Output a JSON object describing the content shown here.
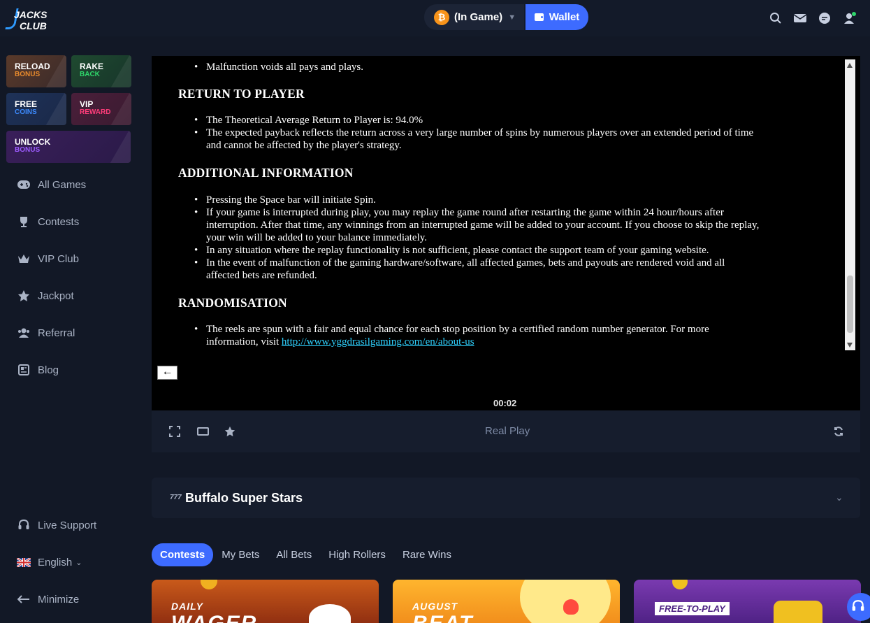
{
  "brand": {
    "logo_line1": "JACKS",
    "logo_line2": "CLUB"
  },
  "header": {
    "balance_label": "(In Game)",
    "currency_icon": "bitcoin-icon",
    "wallet_label": "Wallet",
    "icons": [
      "search-icon",
      "mail-icon",
      "chat-icon",
      "user-icon"
    ]
  },
  "promos": [
    {
      "line1": "RELOAD",
      "line2": "BONUS",
      "color": "#e88a2d"
    },
    {
      "line1": "RAKE",
      "line2": "BACK",
      "color": "#2fd56a"
    },
    {
      "line1": "FREE",
      "line2": "COINS",
      "color": "#3d8bff"
    },
    {
      "line1": "VIP",
      "line2": "REWARD",
      "color": "#ff3d7a"
    },
    {
      "line1": "UNLOCK",
      "line2": "BONUS",
      "color": "#9d5bff"
    }
  ],
  "sidebar": {
    "items": [
      {
        "label": "All Games",
        "icon": "gamepad-icon"
      },
      {
        "label": "Contests",
        "icon": "trophy-icon"
      },
      {
        "label": "VIP Club",
        "icon": "crown-icon"
      },
      {
        "label": "Jackpot",
        "icon": "star-icon"
      },
      {
        "label": "Referral",
        "icon": "people-icon"
      },
      {
        "label": "Blog",
        "icon": "blog-icon"
      }
    ],
    "bottom": [
      {
        "label": "Live Support",
        "icon": "headset-icon"
      },
      {
        "label": "English",
        "icon": "uk-flag-icon"
      },
      {
        "label": "Minimize",
        "icon": "minimize-icon"
      }
    ]
  },
  "rules": {
    "line_top": "Malfunction voids all pays and plays.",
    "h_rtp": "RETURN TO PLAYER",
    "rtp_1": "The Theoretical Average Return to Player is: 94.0%",
    "rtp_2a": "The expected payback reflects the return across a very large number of spins by numerous players over an extended period of time",
    "rtp_2b": "and cannot be affected by the player's strategy.",
    "h_add": "ADDITIONAL INFORMATION",
    "add_1": "Pressing the Space bar will initiate Spin.",
    "add_2a": "If your game is interrupted during play, you may replay the game round after restarting the game within 24 hour/hours after",
    "add_2b": "interruption. After that time, any winnings from an interrupted game will be added to your account. If you choose to skip the replay,",
    "add_2c": "your win will be added to your balance immediately.",
    "add_3": "In any situation where the replay functionality is not sufficient, please contact the support team of your gaming website.",
    "add_4a": "In the event of malfunction of the gaming hardware/software, all affected games, bets and payouts are rendered void and all",
    "add_4b": "affected bets are refunded.",
    "h_rand": "RANDOMISATION",
    "rand_1a": "The reels are spun with a fair and equal chance for each stop position by a certified random number generator. For more",
    "rand_1b": "information, visit ",
    "rand_link": "http://www.yggdrasilgaming.com/en/about-us"
  },
  "player": {
    "back_label": "←",
    "timer": "00:02",
    "mode": "Real Play"
  },
  "game": {
    "title": "Buffalo Super Stars",
    "title_icon_text": "777"
  },
  "tabs": [
    "Contests",
    "My Bets",
    "All Bets",
    "High Rollers",
    "Rare Wins"
  ],
  "cards": [
    {
      "label": "DAILY",
      "big": "WAGER"
    },
    {
      "label": "AUGUST",
      "big": "BEAT"
    },
    {
      "label": "FREE-TO-PLAY",
      "big": ""
    }
  ]
}
